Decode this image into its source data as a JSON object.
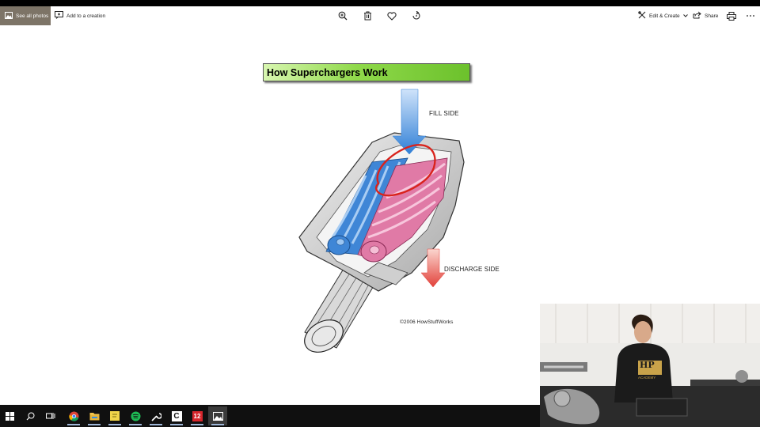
{
  "toolbar": {
    "see_all_photos": "See all photos",
    "add_to_creation": "Add to a creation",
    "edit_create": "Edit & Create",
    "share": "Share",
    "icons": [
      "zoom-in-icon",
      "delete-icon",
      "favorite-icon",
      "rotate-icon",
      "print-icon",
      "more-icon"
    ]
  },
  "image": {
    "title": "How Superchargers Work",
    "fill_side": "FILL SIDE",
    "discharge_side": "DISCHARGE SIDE",
    "copyright": "©2006 HowStuffWorks"
  },
  "webcam": {
    "shirt_logo": "HP",
    "shirt_text": "ACADEMY"
  },
  "taskbar": {
    "apps": [
      "start",
      "search",
      "task-view",
      "chrome",
      "file-explorer",
      "sticky-notes",
      "spotify",
      "tools",
      "app-c",
      "app-12",
      "photos"
    ],
    "app12_label": "12",
    "appc_label": "C"
  },
  "colors": {
    "title_green": "#8fd94a",
    "fill_blue": "#3a86d8",
    "discharge_red": "#e2413a",
    "rotor_pink": "#e07aa6",
    "rotor_blue": "#3f86d6",
    "annotation_red": "#d9231c",
    "see_all_bg": "#7d7467"
  }
}
